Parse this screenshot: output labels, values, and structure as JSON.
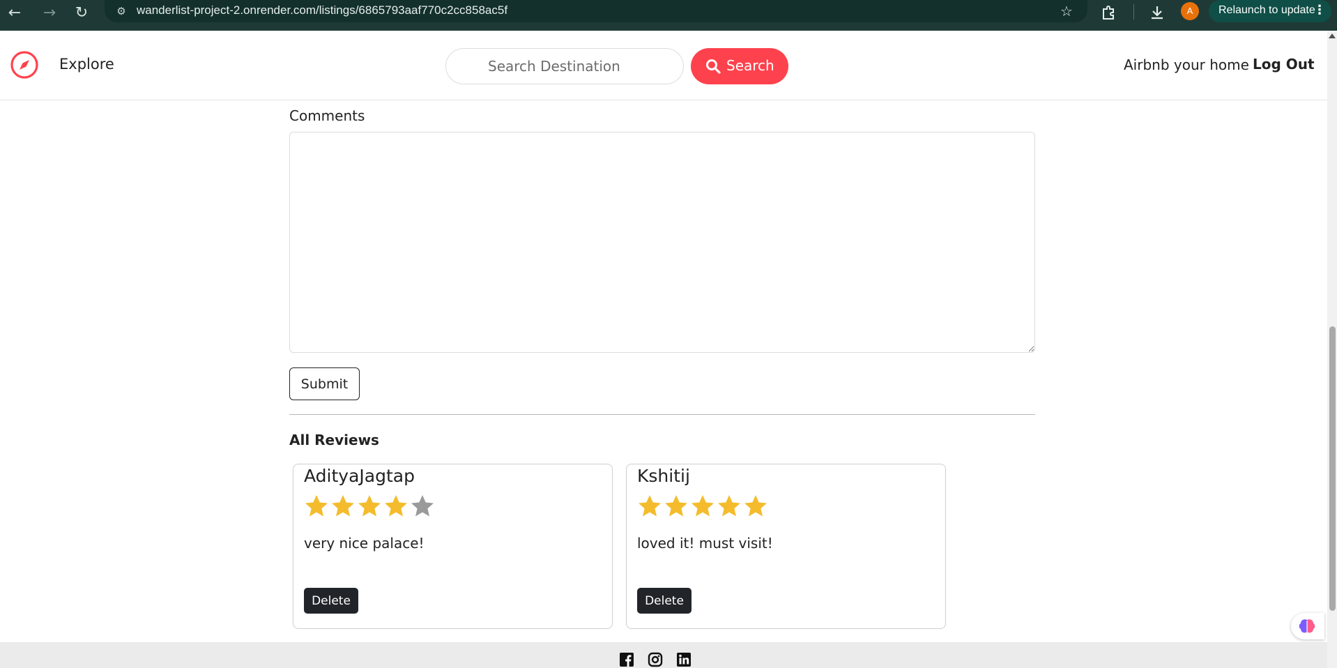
{
  "browser": {
    "url": "wanderlist-project-2.onrender.com/listings/6865793aaf770c2cc858ac5f",
    "profile_initial": "A",
    "relaunch_label": "Relaunch to update"
  },
  "navbar": {
    "explore_label": "Explore",
    "search_placeholder": "Search Destination",
    "search_button_label": "Search",
    "host_label": "Airbnb your home",
    "logout_label": "Log Out",
    "brand_color": "#fe424d"
  },
  "review_form": {
    "comments_label": "Comments",
    "comments_value": "",
    "submit_label": "Submit"
  },
  "reviews": {
    "heading": "All Reviews",
    "items": [
      {
        "author": "AdityaJagtap",
        "rating": 4,
        "max_rating": 5,
        "comment": "very nice palace!",
        "delete_label": "Delete"
      },
      {
        "author": "Kshitij",
        "rating": 5,
        "max_rating": 5,
        "comment": "loved it! must visit!",
        "delete_label": "Delete"
      }
    ]
  },
  "footer": {
    "social_icons": [
      "facebook-icon",
      "instagram-icon",
      "linkedin-icon"
    ]
  },
  "colors": {
    "star_filled": "#f4bc2c",
    "star_empty": "#9a9a9a",
    "delete_button": "#212529"
  }
}
